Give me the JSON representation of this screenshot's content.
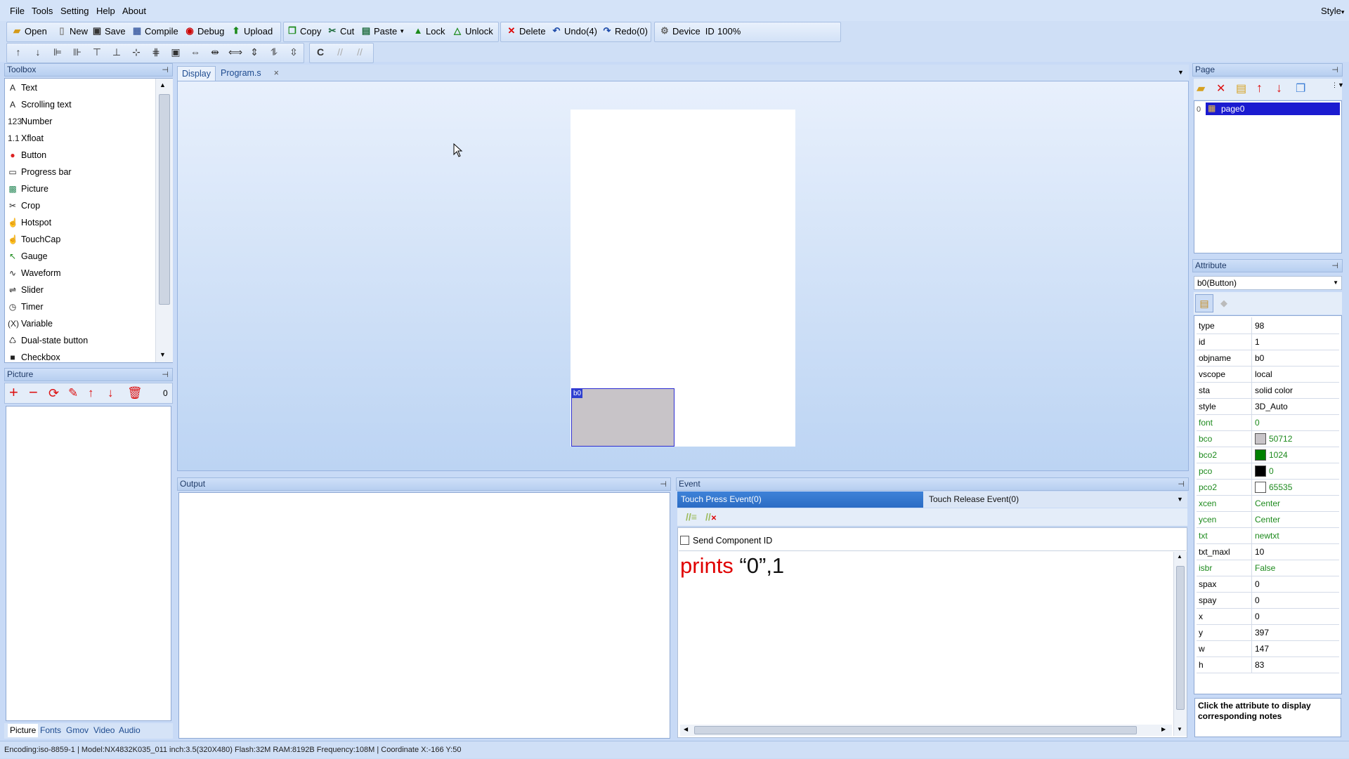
{
  "menu": {
    "file": "File",
    "tools": "Tools",
    "setting": "Setting",
    "help": "Help",
    "about": "About",
    "style": "Style"
  },
  "toolbar": {
    "open": "Open",
    "new": "New",
    "save": "Save",
    "compile": "Compile",
    "debug": "Debug",
    "upload": "Upload",
    "copy": "Copy",
    "cut": "Cut",
    "paste": "Paste",
    "lock": "Lock",
    "unlock": "Unlock",
    "delete": "Delete",
    "undo": "Undo(4)",
    "redo": "Redo(0)",
    "device_id": "Device",
    "id_label": "ID",
    "zoom": "100%"
  },
  "toolbox": {
    "title": "Toolbox",
    "items": [
      "Text",
      "Scrolling text",
      "Number",
      "Xfloat",
      "Button",
      "Progress bar",
      "Picture",
      "Crop",
      "Hotspot",
      "TouchCap",
      "Gauge",
      "Waveform",
      "Slider",
      "Timer",
      "Variable",
      "Dual-state button",
      "Checkbox"
    ]
  },
  "picture_panel": {
    "title": "Picture",
    "count": "0"
  },
  "bottom_tabs": [
    "Picture",
    "Fonts",
    "Gmov",
    "Video",
    "Audio"
  ],
  "doc_tabs": {
    "display": "Display",
    "program": "Program.s"
  },
  "canvas": {
    "widget_tag": "b0"
  },
  "output": {
    "title": "Output"
  },
  "event": {
    "title": "Event",
    "touch_press": "Touch Press Event(0)",
    "touch_release": "Touch Release Event(0)",
    "send_component_id": "Send Component ID",
    "code_keyword": "prints",
    "code_args": " “0”,1"
  },
  "page_panel": {
    "title": "Page",
    "index": "0",
    "page_name": "page0"
  },
  "attribute_panel": {
    "title": "Attribute",
    "selected": "b0(Button)",
    "notes": "Click the attribute to display corresponding notes",
    "rows": [
      {
        "key": "type",
        "val": "98",
        "green": false
      },
      {
        "key": "id",
        "val": "1",
        "green": false
      },
      {
        "key": "objname",
        "val": "b0",
        "green": false
      },
      {
        "key": "vscope",
        "val": "local",
        "green": false
      },
      {
        "key": "sta",
        "val": "solid color",
        "green": false
      },
      {
        "key": "style",
        "val": "3D_Auto",
        "green": false
      },
      {
        "key": "font",
        "val": "0",
        "green": true
      },
      {
        "key": "bco",
        "val": "50712",
        "green": true,
        "swatch": "#c8c4c8"
      },
      {
        "key": "bco2",
        "val": "1024",
        "green": true,
        "swatch": "#008000"
      },
      {
        "key": "pco",
        "val": "0",
        "green": true,
        "swatch": "#000000"
      },
      {
        "key": "pco2",
        "val": "65535",
        "green": true,
        "swatch": "#ffffff"
      },
      {
        "key": "xcen",
        "val": "Center",
        "green": true
      },
      {
        "key": "ycen",
        "val": "Center",
        "green": true
      },
      {
        "key": "txt",
        "val": "newtxt",
        "green": true
      },
      {
        "key": "txt_maxl",
        "val": "10",
        "green": false
      },
      {
        "key": "isbr",
        "val": "False",
        "green": true
      },
      {
        "key": "spax",
        "val": "0",
        "green": false
      },
      {
        "key": "spay",
        "val": "0",
        "green": false
      },
      {
        "key": "x",
        "val": "0",
        "green": false
      },
      {
        "key": "y",
        "val": "397",
        "green": false
      },
      {
        "key": "w",
        "val": "147",
        "green": false
      },
      {
        "key": "h",
        "val": "83",
        "green": false
      }
    ]
  },
  "status": "Encoding:iso-8859-1 | Model:NX4832K035_011 inch:3.5(320X480) Flash:32M RAM:8192B Frequency:108M |   Coordinate X:-166  Y:50",
  "colors": {
    "accent": "#2b6cc4",
    "selection": "#1b1bd0",
    "code_keyword": "#e00000"
  }
}
